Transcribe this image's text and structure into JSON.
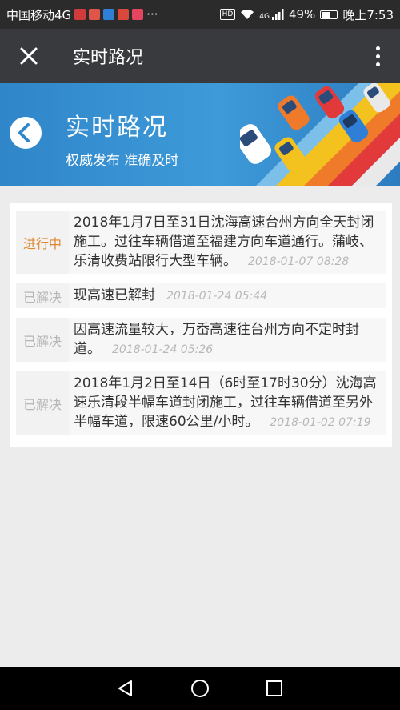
{
  "status_bar": {
    "carrier": "中国移动4G",
    "hd": "HD",
    "signal": "4G",
    "battery": "49%",
    "time": "晚上7:53",
    "more": "···"
  },
  "title_bar": {
    "title": "实时路况"
  },
  "banner": {
    "title": "实时路况",
    "subtitle": "权威发布 准确及时"
  },
  "items": [
    {
      "status": "进行中",
      "status_type": "active",
      "text": "2018年1月7日至31日沈海高速台州方向全天封闭施工。过往车辆借道至福建方向车道通行。蒲岐、乐清收费站限行大型车辆。",
      "time": "2018-01-07 08:28"
    },
    {
      "status": "已解决",
      "status_type": "done",
      "text": "现高速已解封",
      "time": "2018-01-24 05:44"
    },
    {
      "status": "已解决",
      "status_type": "done",
      "text": "因高速流量较大，万岙高速往台州方向不定时封道。",
      "time": "2018-01-24 05:26"
    },
    {
      "status": "已解决",
      "status_type": "done",
      "text": "2018年1月2日至14日（6时至17时30分）沈海高速乐清段半幅车道封闭施工，过往车辆借道至另外半幅车道，限速60公里/小时。",
      "time": "2018-01-02 07:19"
    }
  ],
  "colors": {
    "status_bar": "#2b2b2b",
    "title_bar": "#393a3e",
    "banner": "#3e9ad9",
    "active": "#e0882f",
    "done": "#b7b7b7"
  }
}
